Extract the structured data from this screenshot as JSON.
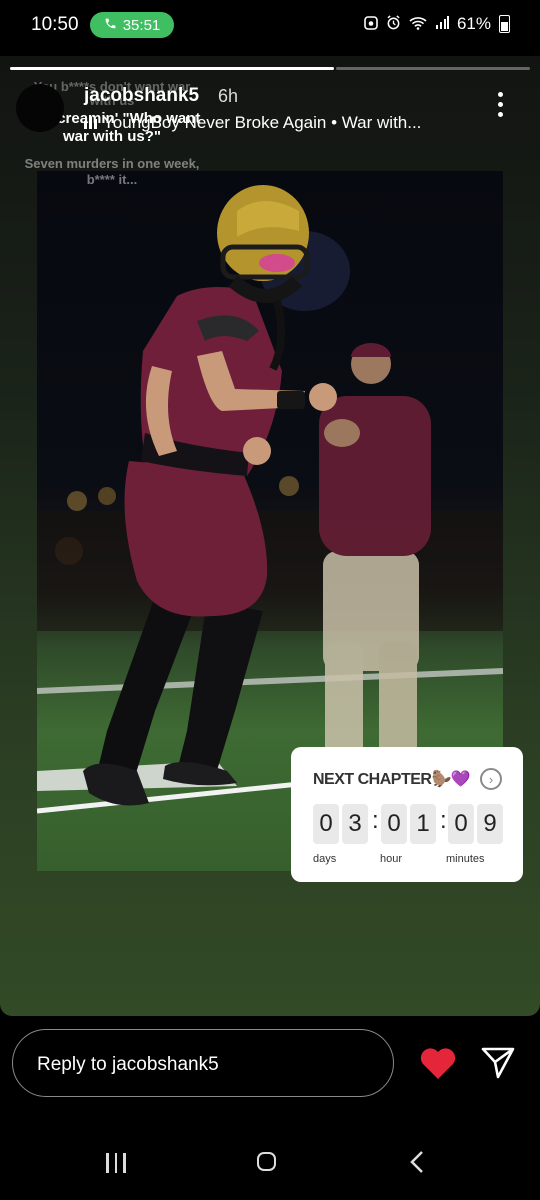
{
  "status_bar": {
    "time": "10:50",
    "call_timer": "35:51",
    "battery": "61%",
    "icons": [
      "screenshot-icon",
      "alarm-icon",
      "wifi-icon",
      "signal-icon",
      "battery-icon"
    ]
  },
  "story": {
    "username": "jacobshank5",
    "posted_ago": "6h",
    "music": "YoungBoy Never Broke Again • War with...",
    "progress": [
      1,
      0.35
    ],
    "lyrics": {
      "previous": "You b****s don't want war with us",
      "current": "I'm screamin' \"Who want war with us?\"",
      "next": "Seven murders in one week, b**** it..."
    }
  },
  "countdown": {
    "title": "NEXT CHAPTER🦫💜",
    "digits": [
      "0",
      "3",
      "0",
      "1",
      "0",
      "9"
    ],
    "labels": [
      "days",
      "hour",
      "minutes"
    ]
  },
  "reply": {
    "placeholder": "Reply to jacobshank5"
  },
  "colors": {
    "call_pill": "#3fbf62",
    "like_heart": "#e5263a"
  }
}
